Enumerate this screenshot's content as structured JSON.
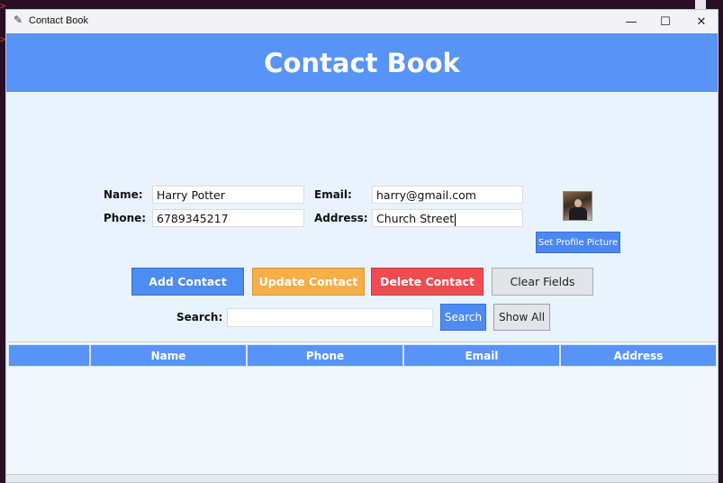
{
  "window": {
    "title": "Contact Book",
    "minimize_glyph": "—",
    "maximize_glyph": "☐",
    "close_glyph": "✕"
  },
  "banner": {
    "title": "Contact Book"
  },
  "form": {
    "name_label": "Name:",
    "name_value": "Harry Potter",
    "phone_label": "Phone:",
    "phone_value": "6789345217",
    "email_label": "Email:",
    "email_value": "harry@gmail.com",
    "address_label": "Address:",
    "address_value": "Church Street",
    "set_profile_label": "Set Profile Picture"
  },
  "actions": {
    "add": "Add Contact",
    "update": "Update Contact",
    "delete": "Delete Contact",
    "clear": "Clear Fields"
  },
  "search": {
    "label": "Search:",
    "value": "",
    "search_button": "Search",
    "show_all_button": "Show All"
  },
  "table": {
    "columns": [
      "",
      "Name",
      "Phone",
      "Email",
      "Address"
    ],
    "rows": []
  },
  "colors": {
    "banner": "#5893f7",
    "add": "#4d8cf3",
    "update": "#f6ae48",
    "delete": "#ef4b50",
    "background": "#e9f3fd"
  }
}
